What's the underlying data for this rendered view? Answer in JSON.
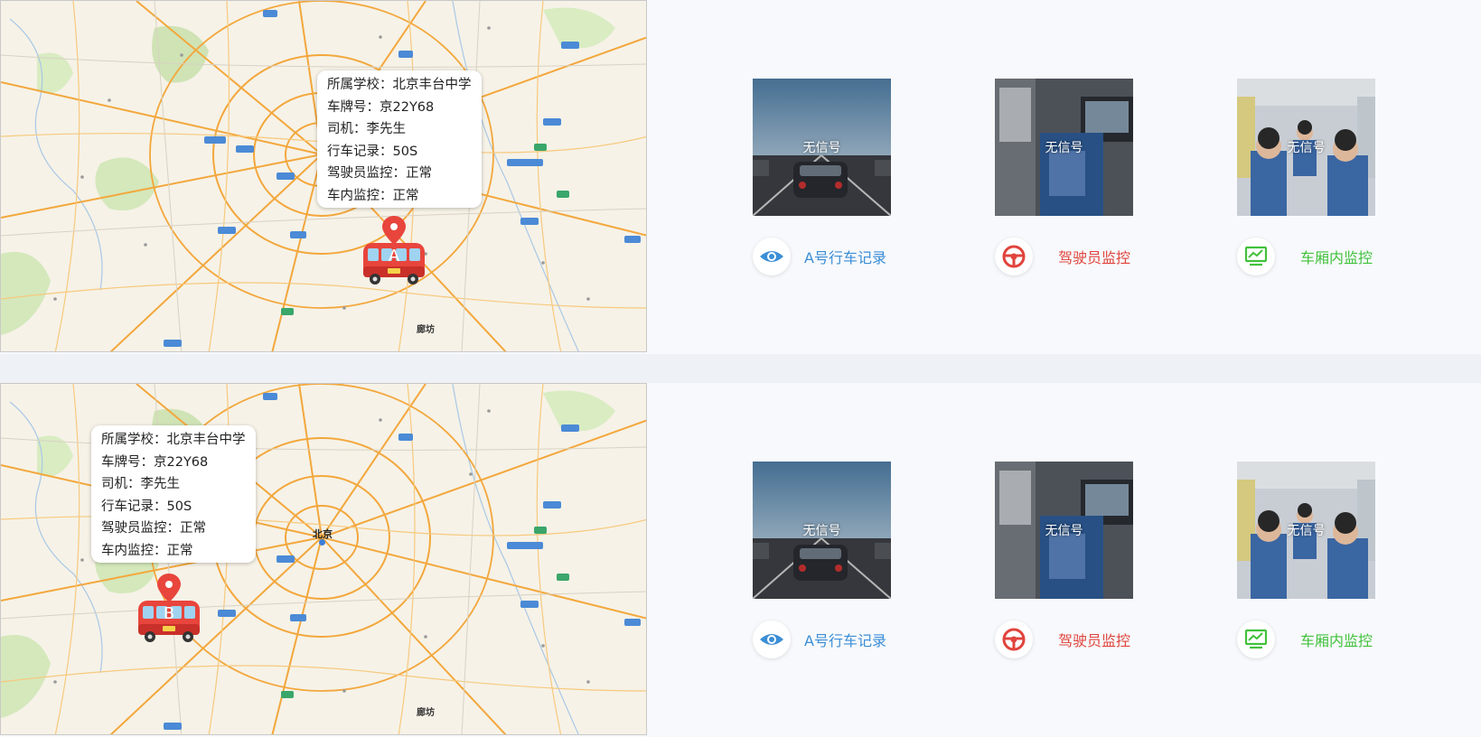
{
  "colors": {
    "record": "#3b8ed6",
    "driver": "#e0443c",
    "cabin": "#41c13b"
  },
  "vehicles": [
    {
      "marker_letter": "A",
      "info": {
        "school": "所属学校：北京丰台中学",
        "plate": "车牌号：京22Y68",
        "driver": "司机：李先生",
        "record": "行车记录：50S",
        "driver_monitor": "驾驶员监控：正常",
        "cabin_monitor": "车内监控：正常"
      },
      "feeds": [
        {
          "status": "无信号",
          "label": "A号行车记录",
          "icon": "eye-icon"
        },
        {
          "status": "无信号",
          "label": "驾驶员监控",
          "icon": "steering-wheel-icon"
        },
        {
          "status": "无信号",
          "label": "车厢内监控",
          "icon": "monitor-chart-icon"
        }
      ]
    },
    {
      "marker_letter": "B",
      "info": {
        "school": "所属学校：北京丰台中学",
        "plate": "车牌号：京22Y68",
        "driver": "司机：李先生",
        "record": "行车记录：50S",
        "driver_monitor": "驾驶员监控：正常",
        "cabin_monitor": "车内监控：正常"
      },
      "feeds": [
        {
          "status": "无信号",
          "label": "A号行车记录",
          "icon": "eye-icon"
        },
        {
          "status": "无信号",
          "label": "驾驶员监控",
          "icon": "steering-wheel-icon"
        },
        {
          "status": "无信号",
          "label": "车厢内监控",
          "icon": "monitor-chart-icon"
        }
      ]
    }
  ],
  "map_labels": {
    "city": "北京",
    "langfang": "廊坊"
  }
}
